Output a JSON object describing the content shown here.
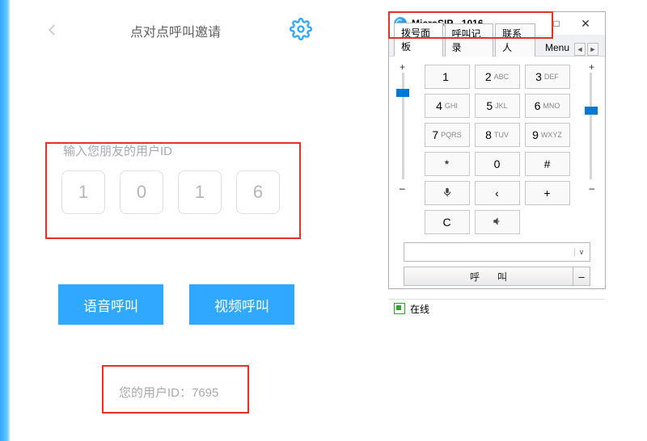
{
  "left": {
    "title": "点对点呼叫邀请",
    "inputLabel": "输入您朋友的用户ID",
    "digits": [
      "1",
      "0",
      "1",
      "6"
    ],
    "voiceCall": "语音呼叫",
    "videoCall": "视频呼叫",
    "myIdLabel": "您的用户ID：7695"
  },
  "microsip": {
    "title": "MicroSIP - 1016",
    "minimize": "—",
    "maximize": "□",
    "close": "✕",
    "tabs": {
      "dial": "拨号面板",
      "history": "呼叫记录",
      "contacts": "联系人",
      "menu": "Menu"
    },
    "keys": {
      "k1": {
        "d": "1",
        "s": ""
      },
      "k2": {
        "d": "2",
        "s": "ABC"
      },
      "k3": {
        "d": "3",
        "s": "DEF"
      },
      "k4": {
        "d": "4",
        "s": "GHI"
      },
      "k5": {
        "d": "5",
        "s": "JKL"
      },
      "k6": {
        "d": "6",
        "s": "MNO"
      },
      "k7": {
        "d": "7",
        "s": "PQRS"
      },
      "k8": {
        "d": "8",
        "s": "TUV"
      },
      "k9": {
        "d": "9",
        "s": "WXYZ"
      },
      "kstar": {
        "d": "*",
        "s": ""
      },
      "k0": {
        "d": "0",
        "s": ""
      },
      "khash": {
        "d": "#",
        "s": ""
      },
      "kback": "‹",
      "kplus": "+",
      "kclear": "C"
    },
    "call": "呼叫",
    "extra": "–",
    "plus": "+",
    "minus": "–",
    "status": "在线",
    "arrowL": "◄",
    "arrowR": "►",
    "caret": "∨"
  }
}
